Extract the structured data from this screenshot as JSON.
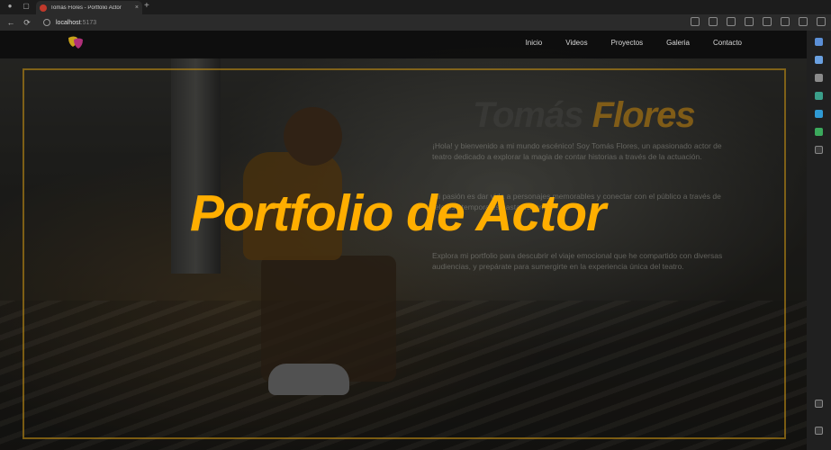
{
  "browser": {
    "tab_title": "Tomás Flores - Portfolio Actor",
    "new_tab_symbol": "+",
    "tab_close_symbol": "×",
    "url_host": "localhost",
    "url_port": ":5173",
    "back_symbol": "←",
    "reload_symbol": "⟳"
  },
  "site": {
    "nav": {
      "items": [
        "Inicio",
        "Videos",
        "Proyectos",
        "Galeria",
        "Contacto"
      ]
    },
    "hero": {
      "first_name": "Tomás",
      "last_name": "Flores",
      "paragraphs": [
        "¡Hola! y bienvenido a mi mundo escénico! Soy Tomás Flores, un apasionado actor de teatro dedicado a explorar la magia de contar historias a través de la actuación.",
        "Mi pasión es dar vida a personajes memorables y conectar con el público a través de relatos atemporales hasta transmitir",
        "Explora mi portfolio para descubrir el viaje emocional que he compartido con diversas audiencias, y prepárate para sumergirte en la experiencia única del teatro."
      ]
    },
    "headline": "Portfolio de Actor"
  },
  "colors": {
    "accent": "#ffae00",
    "frame": "#be8c14"
  }
}
